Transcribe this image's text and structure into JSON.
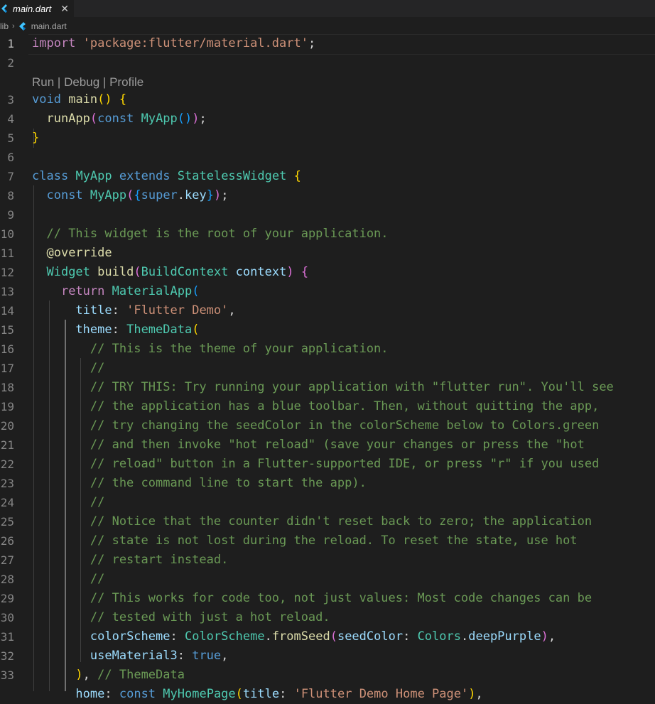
{
  "tab": {
    "label": "main.dart",
    "close": "✕"
  },
  "breadcrumb": {
    "folder": "lib",
    "separator": "›",
    "file": "main.dart"
  },
  "code_lens": {
    "run": "Run",
    "debug": "Debug",
    "profile": "Profile",
    "divider": "|"
  },
  "line_numbers": [
    "1",
    "2",
    "3",
    "4",
    "5",
    "6",
    "7",
    "8",
    "9",
    "10",
    "11",
    "12",
    "13",
    "14",
    "15",
    "16",
    "17",
    "18",
    "19",
    "20",
    "21",
    "22",
    "23",
    "24",
    "25",
    "26",
    "27",
    "28",
    "29",
    "30",
    "31",
    "32",
    "33"
  ],
  "code": {
    "l1": [
      "import",
      " ",
      "'package:flutter/material.dart'",
      ";"
    ],
    "l3": [
      "void",
      " ",
      "main",
      "()",
      " ",
      "{"
    ],
    "l4": [
      "  ",
      "runApp",
      "(",
      "const",
      " ",
      "MyApp",
      "()",
      ")",
      ";"
    ],
    "l5": [
      "}"
    ],
    "l7": [
      "class",
      " ",
      "MyApp",
      " ",
      "extends",
      " ",
      "StatelessWidget",
      " ",
      "{"
    ],
    "l8": [
      "  ",
      "const",
      " ",
      "MyApp",
      "(",
      "{",
      "super",
      ".",
      "key",
      "}",
      ")",
      ";"
    ],
    "l10": [
      "  ",
      "// This widget is the root of your application."
    ],
    "l11": [
      "  ",
      "@override"
    ],
    "l12": [
      "  ",
      "Widget",
      " ",
      "build",
      "(",
      "BuildContext",
      " ",
      "context",
      ")",
      " ",
      "{"
    ],
    "l13": [
      "    ",
      "return",
      " ",
      "MaterialApp",
      "("
    ],
    "l14": [
      "      ",
      "title",
      ": ",
      "'Flutter Demo'",
      ","
    ],
    "l15": [
      "      ",
      "theme",
      ": ",
      "ThemeData",
      "("
    ],
    "l16": "        // This is the theme of your application.",
    "l17": "        //",
    "l18": "        // TRY THIS: Try running your application with \"flutter run\". You'll see",
    "l19": "        // the application has a blue toolbar. Then, without quitting the app,",
    "l20": "        // try changing the seedColor in the colorScheme below to Colors.green",
    "l21": "        // and then invoke \"hot reload\" (save your changes or press the \"hot",
    "l22": "        // reload\" button in a Flutter-supported IDE, or press \"r\" if you used",
    "l23": "        // the command line to start the app).",
    "l24": "        //",
    "l25": "        // Notice that the counter didn't reset back to zero; the application",
    "l26": "        // state is not lost during the reload. To reset the state, use hot",
    "l27": "        // restart instead.",
    "l28": "        //",
    "l29": "        // This works for code too, not just values: Most code changes can be",
    "l30": "        // tested with just a hot reload.",
    "l31": [
      "        ",
      "colorScheme",
      ": ",
      "ColorScheme",
      ".",
      "fromSeed",
      "(",
      "seedColor",
      ": ",
      "Colors",
      ".",
      "deepPurple",
      ")",
      ","
    ],
    "l32": [
      "        ",
      "useMaterial3",
      ": ",
      "true",
      ","
    ],
    "l33": [
      "      ",
      ")",
      ", ",
      "// ThemeData"
    ],
    "l34": [
      "      ",
      "home",
      ": ",
      "const",
      " ",
      "MyHomePage",
      "(",
      "title",
      ": ",
      "'Flutter Demo Home Page'",
      ")",
      ","
    ]
  },
  "colors": {
    "background": "#1e1e1e",
    "keyword": "#569cd6",
    "control": "#c586c0",
    "string": "#ce9178",
    "function": "#dcdcaa",
    "type": "#4ec9b0",
    "variable": "#9cdcfe",
    "comment": "#6a9955"
  }
}
